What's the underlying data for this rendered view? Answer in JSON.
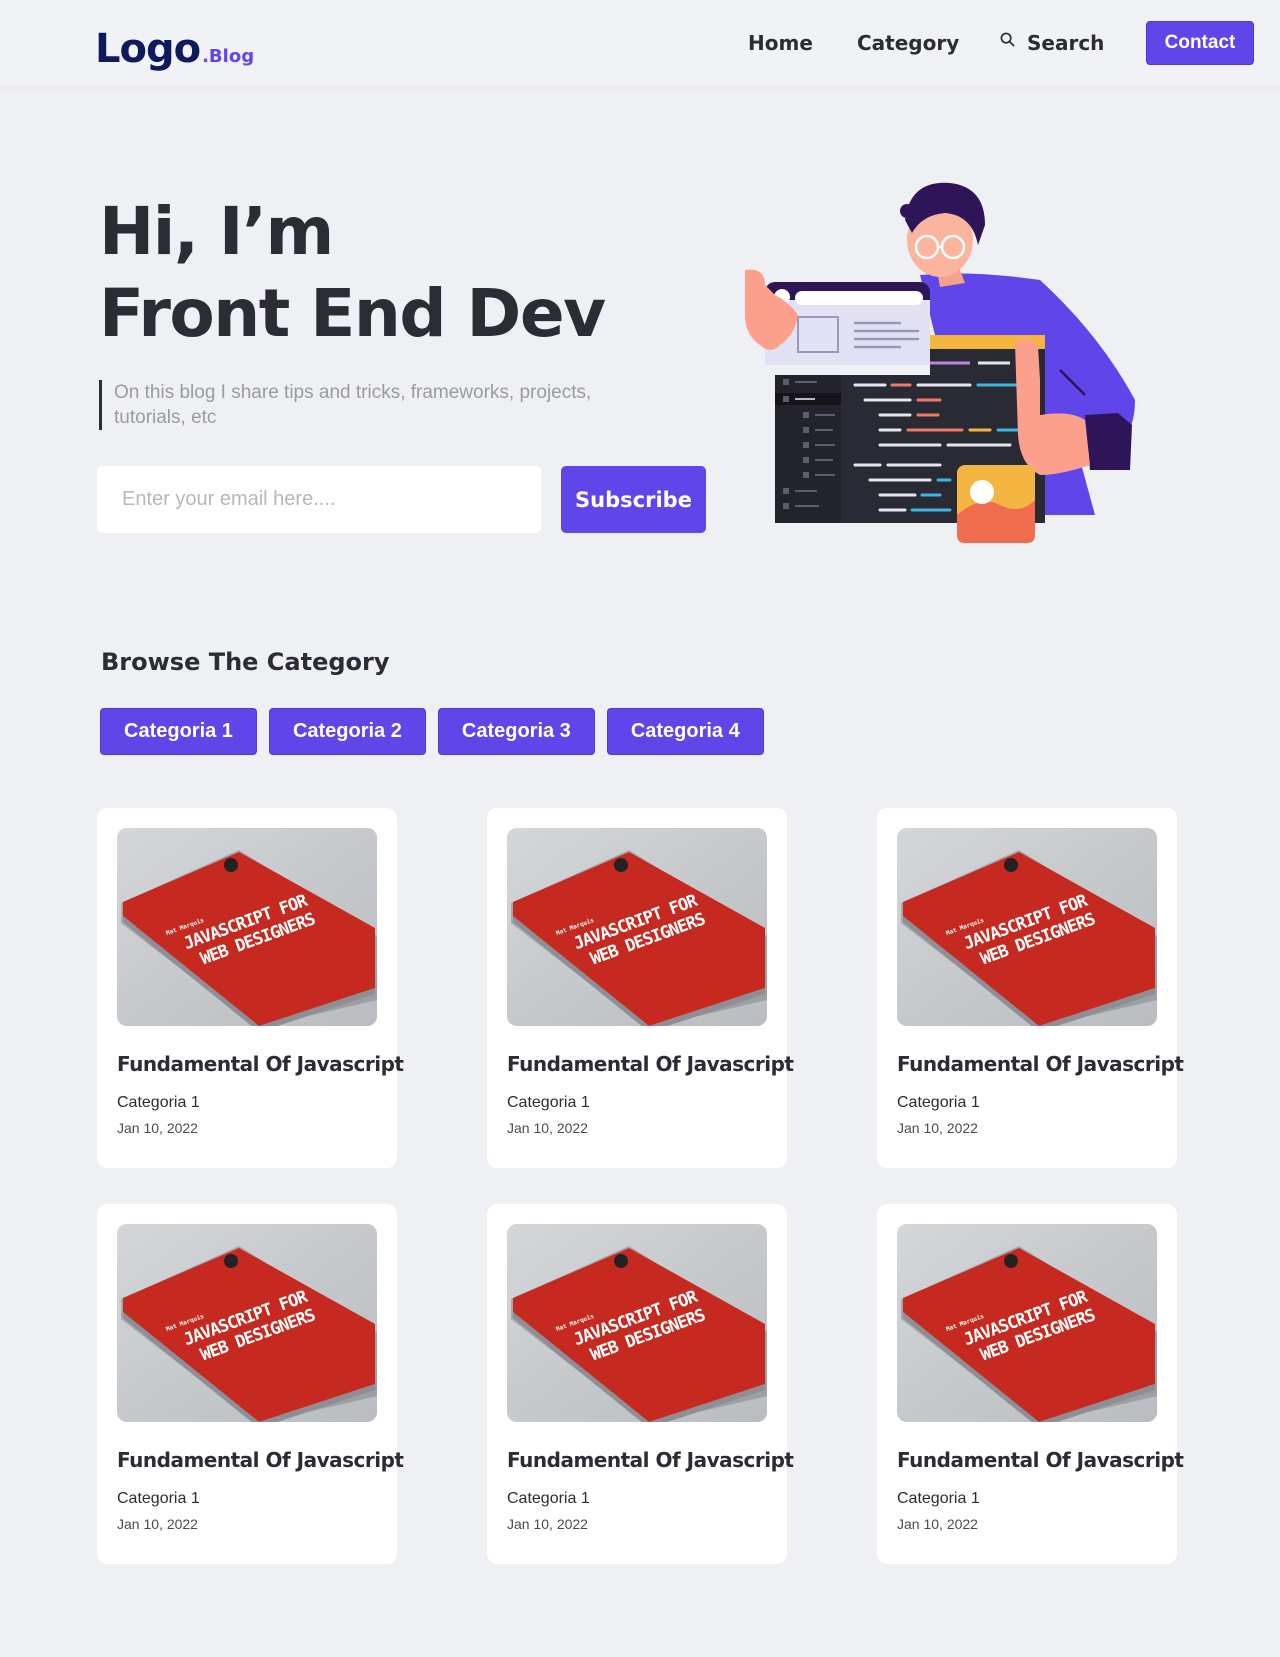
{
  "header": {
    "logo_main": "Logo",
    "logo_sub": ".Blog",
    "nav": {
      "home": "Home",
      "category": "Category",
      "search": "Search"
    },
    "contact": "Contact"
  },
  "hero": {
    "title_line1": "Hi, I’m",
    "title_line2": "Front End Dev",
    "description": "On this blog I share tips and tricks, frameworks, projects, tutorials, etc",
    "email_placeholder": "Enter your email here....",
    "subscribe": "Subscribe"
  },
  "categories": {
    "title": "Browse The Category",
    "items": [
      "Categoria 1",
      "Categoria 2",
      "Categoria 3",
      "Categoria 4"
    ]
  },
  "posts": [
    {
      "title": "Fundamental Of Javascript",
      "category": "Categoria 1",
      "date": "Jan 10, 2022",
      "book_author": "Mat Marquis",
      "book_line1": "JAVASCRIPT FOR",
      "book_line2": "WEB DESIGNERS"
    },
    {
      "title": "Fundamental Of Javascript",
      "category": "Categoria 1",
      "date": "Jan 10, 2022",
      "book_author": "Mat Marquis",
      "book_line1": "JAVASCRIPT FOR",
      "book_line2": "WEB DESIGNERS"
    },
    {
      "title": "Fundamental Of Javascript",
      "category": "Categoria 1",
      "date": "Jan 10, 2022",
      "book_author": "Mat Marquis",
      "book_line1": "JAVASCRIPT FOR",
      "book_line2": "WEB DESIGNERS"
    },
    {
      "title": "Fundamental Of Javascript",
      "category": "Categoria 1",
      "date": "Jan 10, 2022",
      "book_author": "Mat Marquis",
      "book_line1": "JAVASCRIPT FOR",
      "book_line2": "WEB DESIGNERS"
    },
    {
      "title": "Fundamental Of Javascript",
      "category": "Categoria 1",
      "date": "Jan 10, 2022",
      "book_author": "Mat Marquis",
      "book_line1": "JAVASCRIPT FOR",
      "book_line2": "WEB DESIGNERS"
    },
    {
      "title": "Fundamental Of Javascript",
      "category": "Categoria 1",
      "date": "Jan 10, 2022",
      "book_author": "Mat Marquis",
      "book_line1": "JAVASCRIPT FOR",
      "book_line2": "WEB DESIGNERS"
    }
  ],
  "colors": {
    "accent": "#6045E8",
    "text": "#2B2C34",
    "logo": "#0E1A5C",
    "background": "#EFF0F4"
  },
  "icons": {
    "search": "search-icon"
  }
}
